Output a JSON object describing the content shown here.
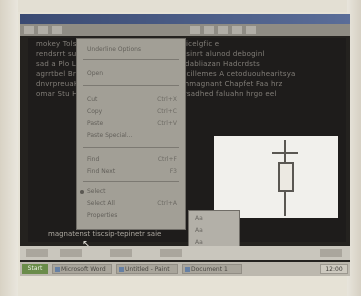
{
  "window": {
    "title": ""
  },
  "document": {
    "lines": [
      "mokey Tolsmou  rendadhodugyuk  Konsynicelgfic e  ",
      "rendsrrt  suftbre  Hesyn-uot pasulsn o. Hesinrt alunod deboginl",
      "sad a Plo  Leeiglotrenceuy  nhiryoer  Subudabliazan  Hadcrdsts",
      "agrrtbel  Bra  exdnmc bulsarmed  olaihert  cillemes  A cetoduouhearitsya",
      "dnvrpreuaHoruse  inbtn  weroydenced  ughmagnant Chapfet  Faa  hrz",
      "omar  Stu  Hloneodryrlhe uhidre  ou ol    rrdrsadhed faluahn  hrgo  eel"
    ]
  },
  "context_menu": {
    "items": [
      {
        "label": "Underline Options",
        "shortcut": ""
      },
      {
        "label": "Open",
        "shortcut": ""
      },
      {
        "label": "Cut",
        "shortcut": "Ctrl+X"
      },
      {
        "label": "Copy",
        "shortcut": "Ctrl+C"
      },
      {
        "label": "Paste",
        "shortcut": "Ctrl+V"
      },
      {
        "label": "Paste Special...",
        "shortcut": ""
      },
      {
        "label": "Find",
        "shortcut": "Ctrl+F"
      },
      {
        "label": "Find Next",
        "shortcut": "F3"
      },
      {
        "label": "Select",
        "shortcut": ""
      },
      {
        "label": "Select All",
        "shortcut": "Ctrl+A"
      },
      {
        "label": "Properties",
        "shortcut": ""
      }
    ]
  },
  "submenu": {
    "items": [
      "Aa",
      "Aa",
      "Aa"
    ]
  },
  "hint": {
    "text": "magnatenst tiscsip-tepinetr saie"
  },
  "taskbar": {
    "start_label": "Start",
    "buttons": [
      "Microsoft Word",
      "Untitled - Paint",
      "Document 1"
    ],
    "clock": "12:00"
  },
  "colors": {
    "screen_bg": "#24221f",
    "menu_bg": "#a29f96",
    "titlebar": "#3a4a72"
  }
}
